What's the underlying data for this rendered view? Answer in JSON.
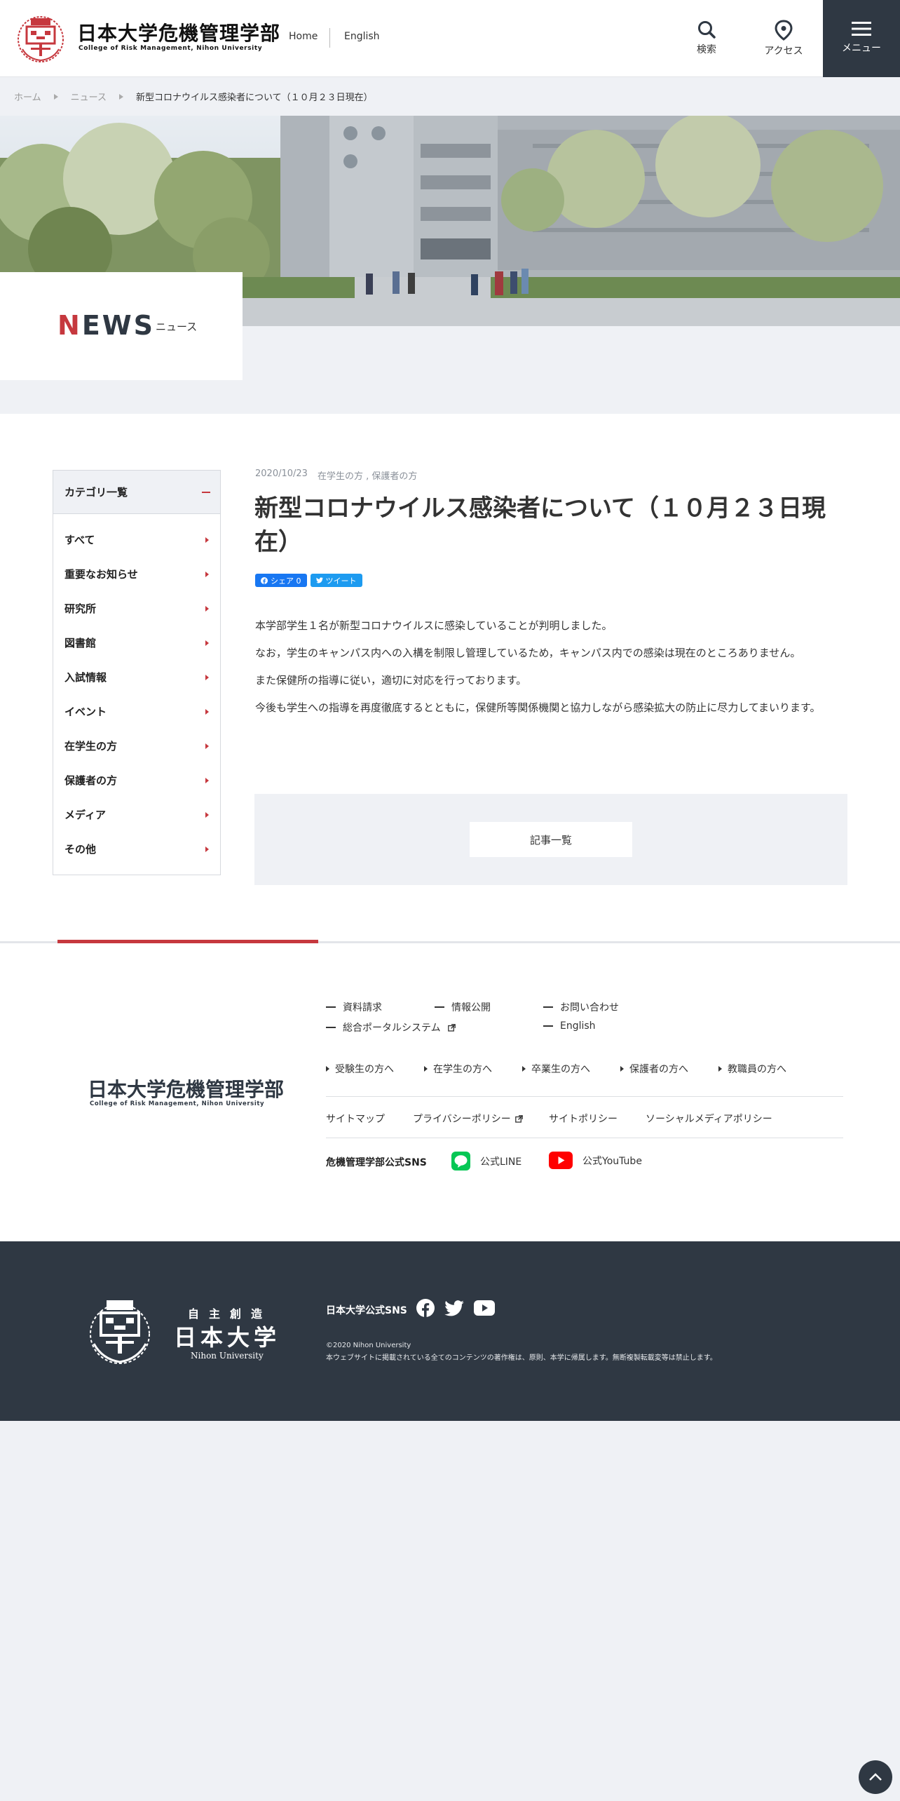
{
  "header": {
    "logo_ja": "日本大学危機管理学部",
    "logo_en": "College of Risk Management, Nihon University",
    "nav_home": "Home",
    "nav_english": "English",
    "search_label": "検索",
    "access_label": "アクセス",
    "menu_label": "メニュー"
  },
  "breadcrumb": {
    "items": [
      "ホーム",
      "ニュース"
    ],
    "current": "新型コロナウイルス感染者について（１０月２３日現在）"
  },
  "hero": {
    "news_word_initial": "N",
    "news_word_rest": "EWS",
    "news_ja": "ニュース"
  },
  "sidebar": {
    "title": "カテゴリ一覧",
    "items": [
      "すべて",
      "重要なお知らせ",
      "研究所",
      "図書館",
      "入試情報",
      "イベント",
      "在学生の方",
      "保護者の方",
      "メディア",
      "その他"
    ]
  },
  "article": {
    "date": "2020/10/23",
    "categories": "在学生の方 , 保護者の方",
    "title": "新型コロナウイルス感染者について（１０月２３日現在）",
    "share_fb": "シェア 0",
    "share_tw": "ツイート",
    "paragraphs": [
      "本学部学生１名が新型コロナウイルスに感染していることが判明しました。",
      "なお，学生のキャンパス内への入構を制限し管理しているため，キャンパス内での感染は現在のところありません。",
      "また保健所の指導に従い，適切に対応を行っております。",
      "今後も学生への指導を再度徹底するとともに，保健所等関係機関と協力しながら感染拡大の防止に尽力してまいります。"
    ],
    "list_button": "記事一覧"
  },
  "footer": {
    "logo_ja": "日本大学危機管理学部",
    "logo_en": "College of Risk Management, Nihon University",
    "links_row1": [
      "資料請求",
      "情報公開",
      "お問い合わせ"
    ],
    "links_row2": [
      "総合ポータルシステム",
      "English"
    ],
    "audience_links": [
      "受験生の方へ",
      "在学生の方へ",
      "卒業生の方へ",
      "保護者の方へ",
      "教職員の方へ"
    ],
    "policy_links": [
      "サイトマップ",
      "プライバシーポリシー",
      "サイトポリシー",
      "ソーシャルメディアポリシー"
    ],
    "sns_label": "危機管理学部公式SNS",
    "sns_line": "公式LINE",
    "sns_youtube": "公式YouTube"
  },
  "footer_dark": {
    "motto": "自主創造",
    "univ_name": "日本大学",
    "univ_en": "Nihon University",
    "sns_label": "日本大学公式SNS",
    "copyright": "©2020 Nihon University",
    "notice": "本ウェブサイトに掲載されている全てのコンテンツの著作権は、原則、本学に帰属します。無断複製転載変等は禁止します。"
  },
  "colors": {
    "accent": "#c6383e",
    "dark": "#2f3843",
    "panel": "#eff1f5"
  }
}
